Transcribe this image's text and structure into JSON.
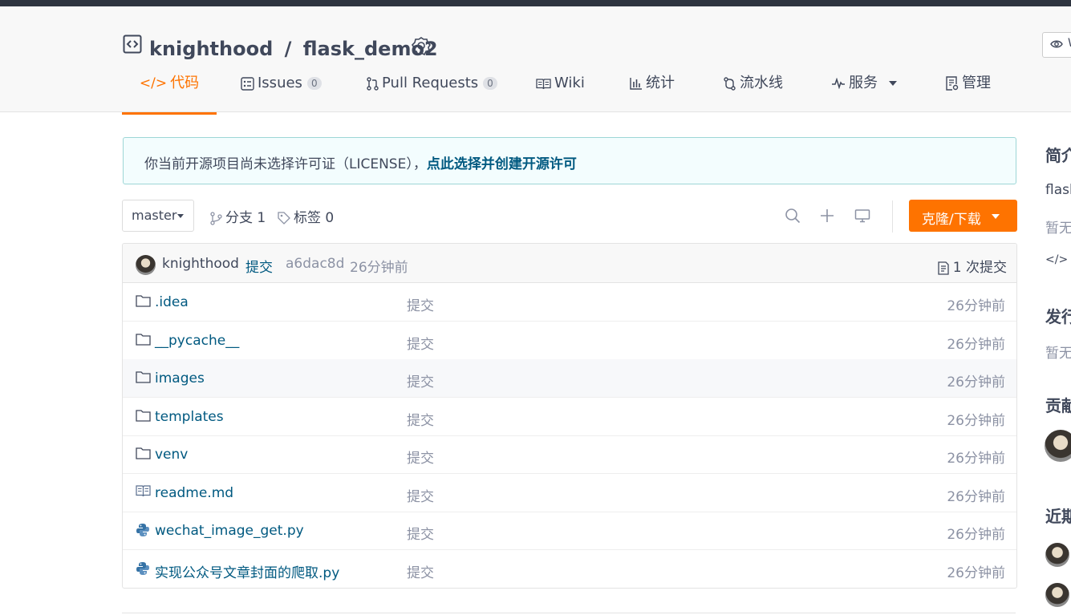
{
  "repo": {
    "owner": "knighthood",
    "separator": "/",
    "name": "flask_demo2",
    "watch_label": "W"
  },
  "tabs": [
    {
      "label": "代码",
      "icon": "code-icon",
      "count": null
    },
    {
      "label": "Issues",
      "icon": "issues-icon",
      "count": "0"
    },
    {
      "label": "Pull Requests",
      "icon": "pull-request-icon",
      "count": "0"
    },
    {
      "label": "Wiki",
      "icon": "book-icon",
      "count": null
    },
    {
      "label": "统计",
      "icon": "bar-chart-icon",
      "count": null
    },
    {
      "label": "流水线",
      "icon": "pipeline-icon",
      "count": null
    },
    {
      "label": "服务",
      "icon": "pulse-icon",
      "count": null
    },
    {
      "label": "管理",
      "icon": "manage-icon",
      "count": null
    }
  ],
  "license_notice": {
    "text": "你当前开源项目尚未选择许可证（LICENSE），",
    "link": "点此选择并创建开源许可"
  },
  "branch": {
    "current": "master",
    "branches_label": "分支 1",
    "tags_label": "标签 0"
  },
  "clone_button": "克隆/下载",
  "last_commit": {
    "author": "knighthood",
    "message": "提交",
    "sha": "a6dac8d",
    "time": "26分钟前",
    "commit_count": "1 次提交"
  },
  "files": [
    {
      "name": ".idea",
      "type": "folder",
      "message": "提交",
      "time": "26分钟前"
    },
    {
      "name": "__pycache__",
      "type": "folder",
      "message": "提交",
      "time": "26分钟前"
    },
    {
      "name": "images",
      "type": "folder",
      "message": "提交",
      "time": "26分钟前"
    },
    {
      "name": "templates",
      "type": "folder",
      "message": "提交",
      "time": "26分钟前"
    },
    {
      "name": "venv",
      "type": "folder",
      "message": "提交",
      "time": "26分钟前"
    },
    {
      "name": "readme.md",
      "type": "markdown",
      "message": "提交",
      "time": "26分钟前"
    },
    {
      "name": "wechat_image_get.py",
      "type": "python",
      "message": "提交",
      "time": "26分钟前"
    },
    {
      "name": "实现公众号文章封面的爬取.py",
      "type": "python",
      "message": "提交",
      "time": "26分钟前"
    }
  ],
  "sidebar": {
    "intro_title": "简介",
    "intro_text": "flask",
    "intro_empty": "暂无",
    "release_title": "发行",
    "release_empty": "暂无",
    "contrib_title": "贡献",
    "recent_title": "近期"
  },
  "colors": {
    "accent": "#fe7300",
    "link": "#005980",
    "muted": "#8c92a4",
    "text": "#40485b"
  }
}
